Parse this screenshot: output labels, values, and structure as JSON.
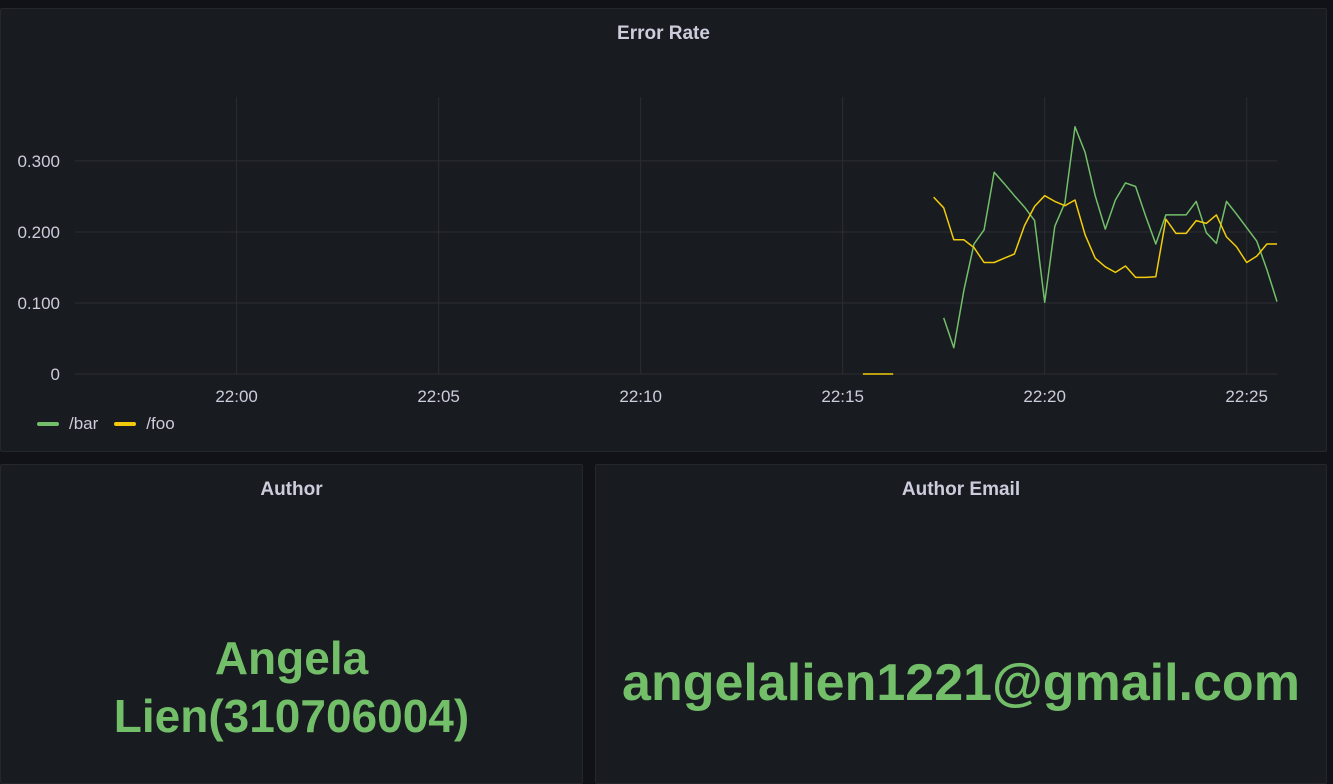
{
  "panels": {
    "error_rate": {
      "title": "Error Rate"
    },
    "author": {
      "title": "Author",
      "value_line1": "Angela",
      "value_line2": "Lien(310706004)"
    },
    "author_email": {
      "title": "Author Email",
      "value": "angelalien1221@gmail.com"
    }
  },
  "colors": {
    "bar": "#73bf69",
    "foo": "#f2cc0c",
    "grid": "#2b2d33"
  },
  "chart_data": {
    "type": "line",
    "title": "Error Rate",
    "xlabel": "",
    "ylabel": "",
    "x_ticks": [
      "22:00",
      "22:05",
      "22:10",
      "22:15",
      "22:20",
      "22:25"
    ],
    "y_ticks": [
      "0",
      "0.100",
      "0.200",
      "0.300"
    ],
    "ylim": [
      0,
      0.39
    ],
    "xlim": [
      "21:56",
      "22:25:45"
    ],
    "grid": true,
    "legend_position": "bottom-left",
    "series": [
      {
        "name": "/bar",
        "color": "#73bf69",
        "points": [
          [
            "22:17:30",
            0.079
          ],
          [
            "22:17:45",
            0.037
          ],
          [
            "22:18:00",
            0.118
          ],
          [
            "22:18:15",
            0.183
          ],
          [
            "22:18:30",
            0.203
          ],
          [
            "22:18:45",
            0.284
          ],
          [
            "22:19:00",
            0.268
          ],
          [
            "22:19:15",
            0.251
          ],
          [
            "22:19:30",
            0.235
          ],
          [
            "22:19:45",
            0.216
          ],
          [
            "22:20:00",
            0.101
          ],
          [
            "22:20:15",
            0.208
          ],
          [
            "22:20:30",
            0.241
          ],
          [
            "22:20:45",
            0.348
          ],
          [
            "22:21:00",
            0.312
          ],
          [
            "22:21:15",
            0.251
          ],
          [
            "22:21:30",
            0.204
          ],
          [
            "22:21:45",
            0.245
          ],
          [
            "22:22:00",
            0.269
          ],
          [
            "22:22:15",
            0.264
          ],
          [
            "22:22:30",
            0.222
          ],
          [
            "22:22:45",
            0.183
          ],
          [
            "22:23:00",
            0.224
          ],
          [
            "22:23:15",
            0.224
          ],
          [
            "22:23:30",
            0.224
          ],
          [
            "22:23:45",
            0.243
          ],
          [
            "22:24:00",
            0.199
          ],
          [
            "22:24:15",
            0.184
          ],
          [
            "22:24:30",
            0.243
          ],
          [
            "22:24:45",
            0.225
          ],
          [
            "22:25:00",
            0.206
          ],
          [
            "22:25:15",
            0.187
          ],
          [
            "22:25:30",
            0.147
          ],
          [
            "22:25:45",
            0.102
          ]
        ]
      },
      {
        "name": "/foo",
        "color": "#f2cc0c",
        "points": [
          [
            "22:15:30",
            0.0
          ],
          [
            "22:16:15",
            0.0
          ],
          null,
          [
            "22:17:15",
            0.249
          ],
          [
            "22:17:30",
            0.234
          ],
          [
            "22:17:45",
            0.189
          ],
          [
            "22:18:00",
            0.189
          ],
          [
            "22:18:15",
            0.178
          ],
          [
            "22:18:30",
            0.157
          ],
          [
            "22:18:45",
            0.157
          ],
          [
            "22:19:00",
            0.163
          ],
          [
            "22:19:15",
            0.169
          ],
          [
            "22:19:30",
            0.209
          ],
          [
            "22:19:45",
            0.236
          ],
          [
            "22:20:00",
            0.251
          ],
          [
            "22:20:15",
            0.243
          ],
          [
            "22:20:30",
            0.237
          ],
          [
            "22:20:45",
            0.245
          ],
          [
            "22:21:00",
            0.196
          ],
          [
            "22:21:15",
            0.163
          ],
          [
            "22:21:30",
            0.151
          ],
          [
            "22:21:45",
            0.143
          ],
          [
            "22:22:00",
            0.152
          ],
          [
            "22:22:15",
            0.136
          ],
          [
            "22:22:30",
            0.136
          ],
          [
            "22:22:45",
            0.137
          ],
          [
            "22:23:00",
            0.218
          ],
          [
            "22:23:15",
            0.198
          ],
          [
            "22:23:30",
            0.198
          ],
          [
            "22:23:45",
            0.216
          ],
          [
            "22:24:00",
            0.212
          ],
          [
            "22:24:15",
            0.224
          ],
          [
            "22:24:30",
            0.193
          ],
          [
            "22:24:45",
            0.179
          ],
          [
            "22:25:00",
            0.157
          ],
          [
            "22:25:15",
            0.166
          ],
          [
            "22:25:30",
            0.183
          ],
          [
            "22:25:45",
            0.183
          ]
        ]
      }
    ]
  }
}
